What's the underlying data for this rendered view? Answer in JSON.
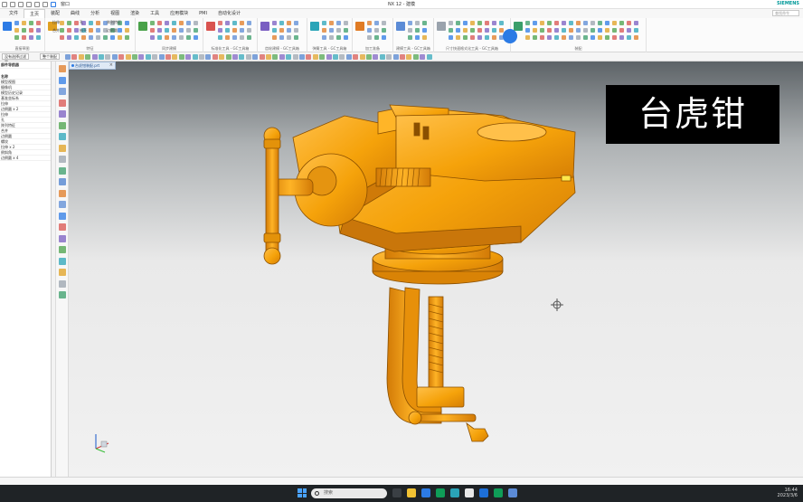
{
  "titlebar": {
    "window_label": "窗口",
    "app_title": "NX 12 - 建模",
    "brand": "SIEMENS"
  },
  "menubar": {
    "items": [
      "文件",
      "主页",
      "装配",
      "曲线",
      "分析",
      "视图",
      "渲染",
      "工具",
      "应用模块",
      "PMI",
      "自动化设计"
    ],
    "active_index": 1,
    "search_placeholder": "查找命令"
  },
  "ribbon": {
    "groups": [
      {
        "label": "直接草图"
      },
      {
        "label": "特征"
      },
      {
        "label": "同步建模"
      },
      {
        "label": "标准化工具 - GC工具箱"
      },
      {
        "label": "齿轮建模 - GC工具箱"
      },
      {
        "label": "弹簧工具 - GC工具箱"
      },
      {
        "label": "加工准备"
      },
      {
        "label": "建模工具 - GC工具箱"
      },
      {
        "label": "尺寸快速格式化工具 - GC工具箱"
      },
      {
        "label": "装配"
      }
    ],
    "small_labels": [
      "拉伸",
      "孔",
      "阵列特征",
      "合并",
      "抽壳",
      "边倒圆",
      "倒斜角",
      "拔模",
      "移动面",
      "替换面",
      "删除面",
      "更多"
    ]
  },
  "cmdbar": {
    "filter_value": "没有选择过滤器",
    "scope_value": "整个装配"
  },
  "tree": {
    "title": "部件导航器",
    "rows": [
      "名称",
      "模型视图",
      "摄像机",
      "模型历史记录",
      "基准坐标系",
      "拉伸",
      "边倒圆 x 2",
      "拉伸",
      "孔",
      "阵列特征",
      "合并",
      "边倒圆",
      "螺纹",
      "拉伸 x 2",
      "倒斜角",
      "边倒圆 x 4"
    ]
  },
  "tab": {
    "label": "台虎钳装配.prt"
  },
  "overlay": {
    "text": "台虎钳"
  },
  "taskbar": {
    "search_placeholder": "搜索",
    "time": "16:44",
    "date": "2023/3/6"
  },
  "colors": {
    "accent": "#2c7be5",
    "model": "#f5a20a",
    "model_dark": "#c8780a"
  }
}
